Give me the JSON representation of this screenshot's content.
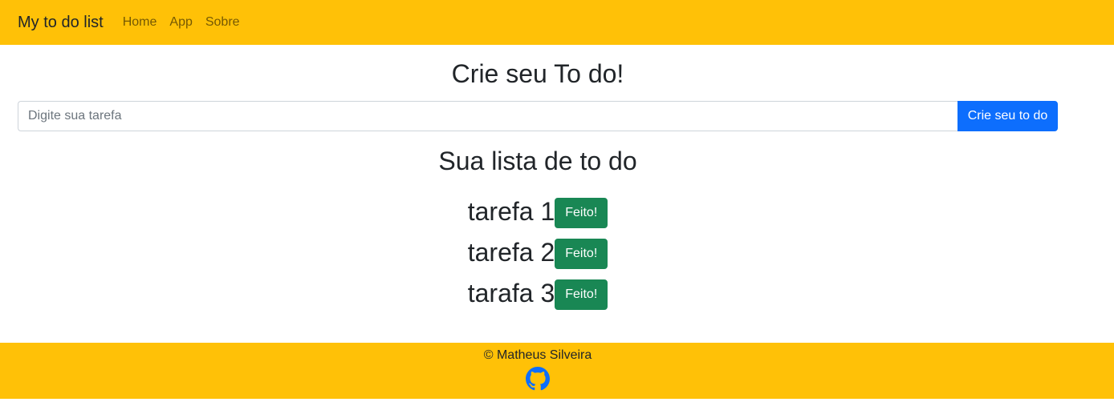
{
  "navbar": {
    "brand": "My to do list",
    "links": [
      "Home",
      "App",
      "Sobre"
    ]
  },
  "main": {
    "title": "Crie seu To do!",
    "input_placeholder": "Digite sua tarefa",
    "input_value": "",
    "create_button": "Crie seu to do",
    "list_title": "Sua lista de to do",
    "done_label": "Feito!",
    "tasks": [
      "tarefa 1",
      "tarefa 2",
      "tarafa 3"
    ]
  },
  "footer": {
    "copyright": "© Matheus Silveira",
    "github_icon": "github-icon"
  },
  "colors": {
    "navbar_bg": "#ffc107",
    "primary": "#0d6efd",
    "success": "#198754",
    "text": "#212529"
  }
}
